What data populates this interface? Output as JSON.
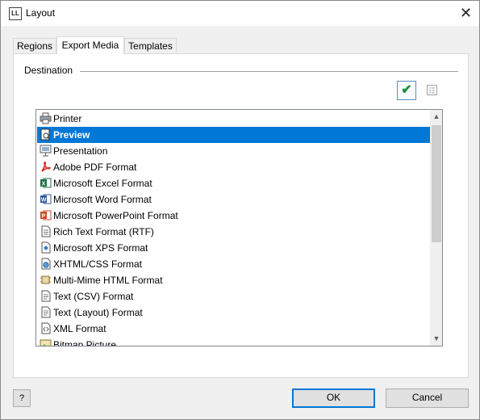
{
  "window": {
    "title": "Layout",
    "app_icon_text": "LL",
    "close_glyph": "✕"
  },
  "tabs": [
    {
      "label": "Regions",
      "active": false
    },
    {
      "label": "Export Media",
      "active": true
    },
    {
      "label": "Templates",
      "active": false
    }
  ],
  "destination": {
    "group_label": "Destination",
    "toolbar": {
      "check_icon": "checkmark-icon",
      "list_icon": "properties-list-icon"
    },
    "items": [
      {
        "label": "Printer",
        "icon": "printer-icon",
        "selected": false
      },
      {
        "label": "Preview",
        "icon": "preview-icon",
        "selected": true
      },
      {
        "label": "Presentation",
        "icon": "presentation-icon",
        "selected": false
      },
      {
        "label": "Adobe PDF Format",
        "icon": "pdf-icon",
        "selected": false
      },
      {
        "label": "Microsoft Excel Format",
        "icon": "excel-icon",
        "selected": false
      },
      {
        "label": "Microsoft Word Format",
        "icon": "word-icon",
        "selected": false
      },
      {
        "label": "Microsoft PowerPoint Format",
        "icon": "powerpoint-icon",
        "selected": false
      },
      {
        "label": "Rich Text Format (RTF)",
        "icon": "document-icon",
        "selected": false
      },
      {
        "label": "Microsoft XPS Format",
        "icon": "xps-icon",
        "selected": false
      },
      {
        "label": "XHTML/CSS Format",
        "icon": "xhtml-icon",
        "selected": false
      },
      {
        "label": "Multi-Mime HTML Format",
        "icon": "mime-html-icon",
        "selected": false
      },
      {
        "label": "Text (CSV) Format",
        "icon": "text-file-icon",
        "selected": false
      },
      {
        "label": "Text (Layout) Format",
        "icon": "text-file-icon",
        "selected": false
      },
      {
        "label": "XML Format",
        "icon": "xml-icon",
        "selected": false
      },
      {
        "label": "Bitmap Picture",
        "icon": "bitmap-icon",
        "selected": false
      }
    ]
  },
  "buttons": {
    "ok": "OK",
    "cancel": "Cancel",
    "help_glyph": "?"
  },
  "colors": {
    "selection": "#0078d7",
    "pdf": "#d4281c",
    "excel": "#1e7145",
    "word": "#2b579a",
    "powerpoint": "#d24726"
  }
}
